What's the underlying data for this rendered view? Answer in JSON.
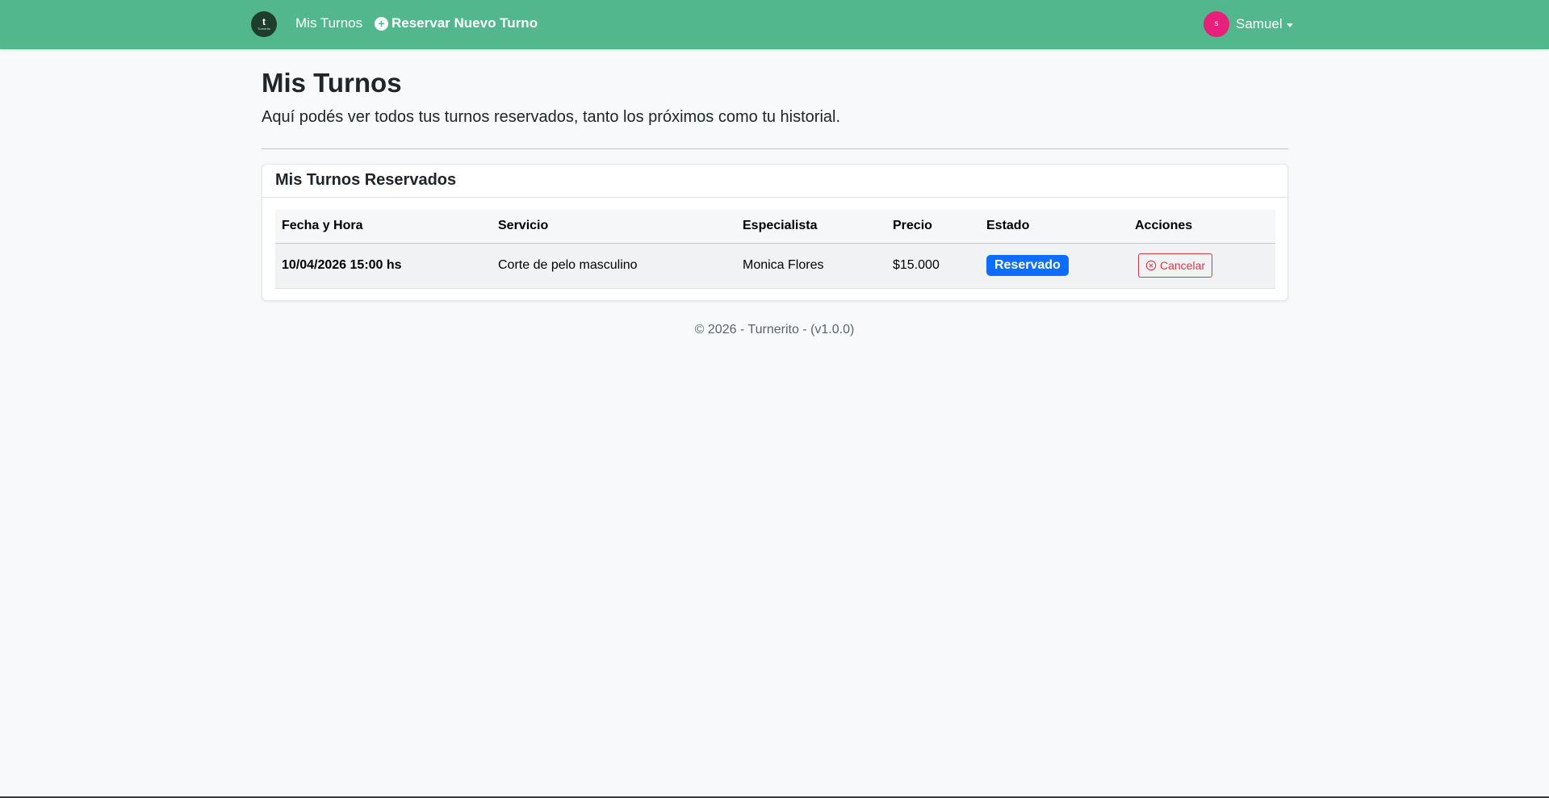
{
  "navbar": {
    "brand_mark": "t",
    "brand_word": "Turnerito",
    "links": [
      {
        "label": "Mis Turnos"
      },
      {
        "label": "Reservar Nuevo Turno",
        "icon": "plus-circle-icon"
      }
    ],
    "user": {
      "initial": "s",
      "name": "Samuel"
    },
    "colors": {
      "navbar": "#52b78c",
      "avatar": "#e8207c"
    }
  },
  "page": {
    "title": "Mis Turnos",
    "subtitle": "Aquí podés ver todos tus turnos reservados, tanto los próximos como tu historial."
  },
  "card": {
    "title": "Mis Turnos Reservados",
    "columns": [
      "Fecha y Hora",
      "Servicio",
      "Especialista",
      "Precio",
      "Estado",
      "Acciones"
    ],
    "rows": [
      {
        "fecha_hora": "10/04/2026 15:00 hs",
        "servicio": "Corte de pelo masculino",
        "especialista": "Monica Flores",
        "precio": "$15.000",
        "estado": "Reservado",
        "accion": "Cancelar"
      }
    ],
    "colors": {
      "badge": "#0d6efd",
      "cancel": "#dc3545"
    }
  },
  "footer": {
    "text": "© 2026 - Turnerito - (v1.0.0)"
  }
}
